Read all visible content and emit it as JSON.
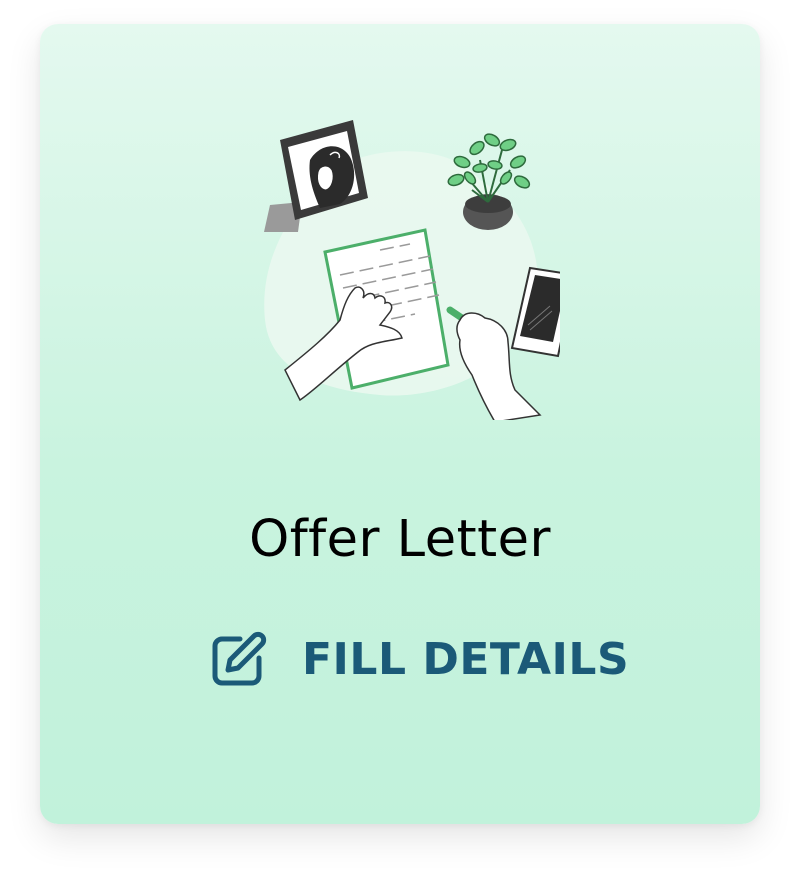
{
  "card": {
    "title": "Offer Letter",
    "action_label": "FILL DETAILS",
    "action_icon": "edit-icon",
    "illustration": "person-signing-document-illustration"
  },
  "colors": {
    "card_gradient_top": "#e4f9ef",
    "card_gradient_bottom": "#c1f2db",
    "title": "#000000",
    "action": "#1b5a78",
    "accent_green": "#4caf6a"
  }
}
